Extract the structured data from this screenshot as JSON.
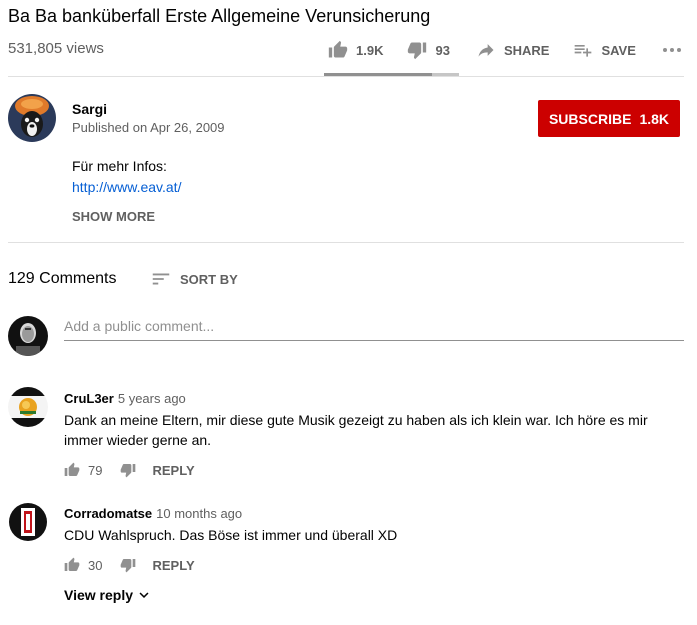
{
  "video": {
    "title": "Ba Ba banküberfall Erste Allgemeine Verunsicherung",
    "views": "531,805 views"
  },
  "actions": {
    "like_count": "1.9K",
    "dislike_count": "93",
    "share_label": "SHARE",
    "save_label": "SAVE",
    "like_ratio": 0.8
  },
  "channel": {
    "name": "Sargi",
    "published": "Published on Apr 26, 2009",
    "subscribe_label": "SUBSCRIBE",
    "subscriber_count": "1.8K"
  },
  "description": {
    "line1": "Für mehr Infos:",
    "link": "http://www.eav.at/",
    "show_more": "SHOW MORE"
  },
  "comments_header": {
    "count": "129 Comments",
    "sort_label": "SORT BY",
    "add_placeholder": "Add a public comment..."
  },
  "comments": [
    {
      "author": "CruL3er",
      "date": "5 years ago",
      "text": "Dank an meine Eltern, mir diese gute Musik gezeigt zu haben als ich klein war. Ich höre es mir immer wieder gerne an.",
      "likes": "79",
      "reply_label": "REPLY"
    },
    {
      "author": "Corradomatse",
      "date": "10 months ago",
      "text": "CDU Wahlspruch. Das Böse ist immer und überall XD",
      "likes": "30",
      "reply_label": "REPLY"
    }
  ],
  "view_reply": {
    "label": "View reply"
  },
  "colors": {
    "subscribe_red": "#cc0000",
    "link_blue": "#065fd4",
    "secondary_text": "#606060",
    "icon_grey": "#909090"
  }
}
